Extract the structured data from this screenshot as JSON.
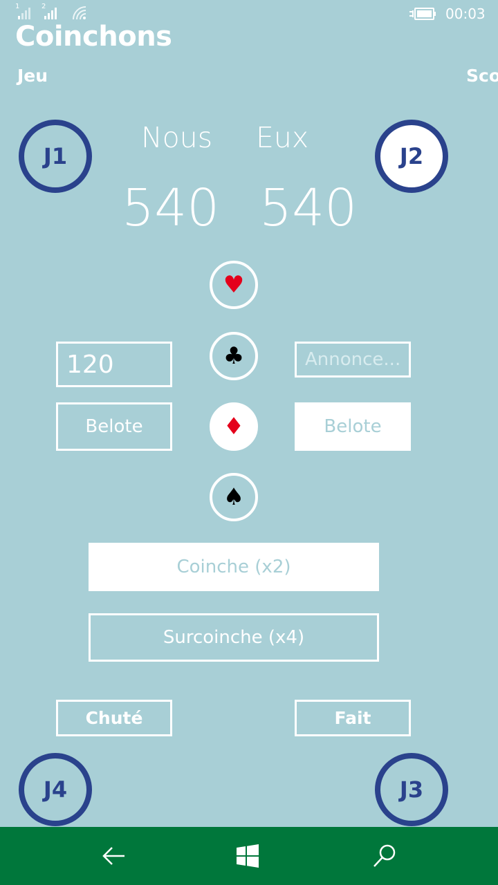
{
  "status_bar": {
    "sim1": "1",
    "sim2": "2",
    "time": "00:03"
  },
  "app": {
    "title": "Coinchons"
  },
  "pivot": {
    "items": [
      "Jeu",
      "Sco"
    ]
  },
  "players": {
    "j1": "J1",
    "j2": "J2",
    "j3": "J3",
    "j4": "J4",
    "active": "J2"
  },
  "teams": {
    "us": {
      "name": "Nous",
      "score": "540"
    },
    "them": {
      "name": "Eux",
      "score": "540"
    }
  },
  "suits": {
    "heart": "♥",
    "club": "♣",
    "diamond": "♦",
    "spade": "♠",
    "selected": "diamond"
  },
  "bid": {
    "left_value": "120",
    "right_placeholder": "Annonce..."
  },
  "belote": {
    "left_label": "Belote",
    "right_label": "Belote"
  },
  "coinche": {
    "coinche_label": "Coinche (x2)",
    "surcoinche_label": "Surcoinche (x4)"
  },
  "result": {
    "chute_label": "Chuté",
    "fait_label": "Fait"
  },
  "icons": {
    "back": "back-arrow-icon",
    "home": "windows-icon",
    "search": "search-icon"
  },
  "colors": {
    "background": "#a8cfd6",
    "player_ring": "#2a428c",
    "red_suit": "#e4001b",
    "appbar": "#00773b"
  }
}
